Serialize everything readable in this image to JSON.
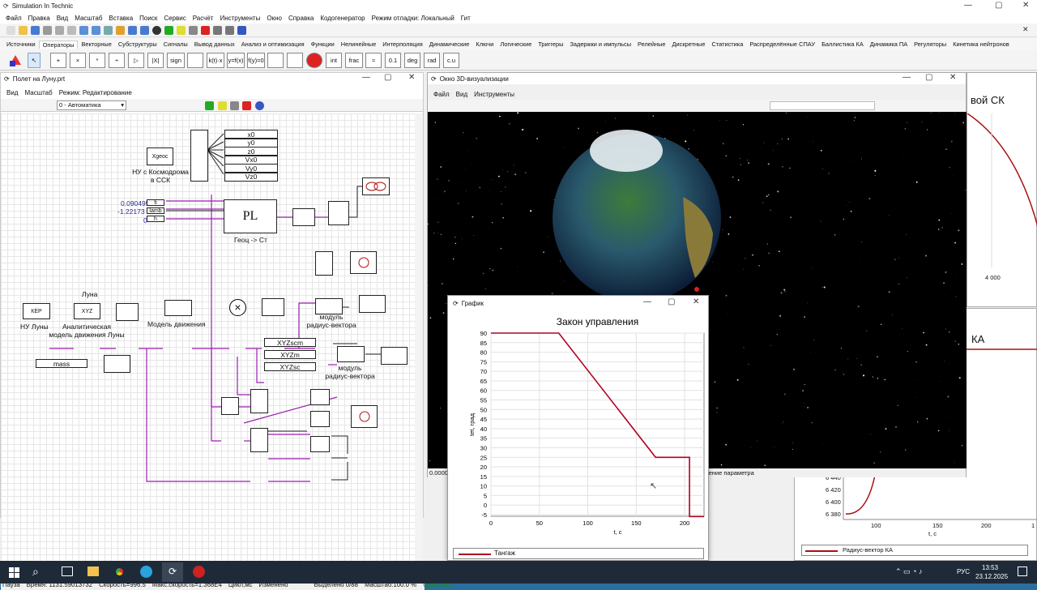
{
  "app": {
    "title": "Simulation In Technic"
  },
  "menu": [
    "Файл",
    "Правка",
    "Вид",
    "Масштаб",
    "Вставка",
    "Поиск",
    "Сервис",
    "Расчёт",
    "Инструменты",
    "Окно",
    "Справка",
    "Кодогенератор",
    "Режим отладки: Локальный",
    "Гит"
  ],
  "tabs": [
    "Источники",
    "Операторы",
    "Векторные",
    "Субструктуры",
    "Сигналы",
    "Вывод данных",
    "Анализ и оптимизация",
    "Функции",
    "Нелинейные",
    "Интерполяция",
    "Динамические",
    "Ключи",
    "Логические",
    "Триггеры",
    "Задержки и импульсы",
    "Релейные",
    "Дискретные",
    "Статистика",
    "Распределённые СПАУ",
    "Баллистика КА",
    "Динамика ПА",
    "Регуляторы",
    "Кинетика нейтронов"
  ],
  "active_tab": "Операторы",
  "operators": [
    "+",
    "×",
    "*",
    "÷",
    "▷",
    "|X|",
    "sign",
    "",
    "k(t)·x",
    "y=f(x)",
    "f(y)=0",
    "",
    "",
    "",
    "int",
    "frac",
    "≈",
    "0.1",
    "deg",
    "rad",
    "c.u"
  ],
  "left_window": {
    "title": "Полет на Луну.prt",
    "menu": [
      "Вид",
      "Масштаб",
      "Режим: Редактирование"
    ],
    "mode_select": "0 - Автоматика",
    "labels": {
      "nu_cosm": "НУ с Космодрома\nв ССК",
      "outputs": [
        "x0",
        "y0",
        "z0",
        "Vx0",
        "Vy0",
        "Vz0"
      ],
      "const1": "0.0904953",
      "const2": "-1.22173",
      "const3": "0",
      "fi": "fi",
      "lamb": "lamb",
      "h": "h",
      "pl": "PL",
      "geoc": "Геоц -> Ст",
      "luna": "Луна",
      "nu_luny": "НУ Луны",
      "analyt": "Аналитическая\nмодель движения Луны",
      "model": "Модель движения",
      "modul1": "модуль\nрадиус-вектора",
      "modul2": "модуль\nрадиус-вектора",
      "xyzscm": "XYZscm",
      "xyzm": "XYZm",
      "xyzsc": "XYZsc",
      "mass": "mass",
      "kep": "КЕР",
      "xyz": "XYZ",
      "xgeoc": "Xgeoc"
    },
    "status": [
      "Пауза",
      "Время: 1131.59013732",
      "Скорость=996.5",
      "Макс.скорость=1.368E4",
      "Цикл,мс",
      "Изменено",
      "Выделено 0/88",
      "Масштаб:100.0 %",
      "Сетка вкл."
    ]
  },
  "win3d": {
    "title": "Окно 3D-визуализации",
    "menu": [
      "Файл",
      "Вид",
      "Инструменты"
    ],
    "bottom_left": "0.00000",
    "bottom_right": "Значение параметра"
  },
  "bg_right_top": {
    "title": "вой СК",
    "tick": "4 000"
  },
  "bg_right_bottom": {
    "title": "КА",
    "ticks_y": [
      "6 440",
      "6 420",
      "6 400",
      "6 380"
    ],
    "ticks_x": [
      "100",
      "150",
      "200",
      "1"
    ],
    "xlabel": "t, c",
    "legend": "Радиус-вектор КА"
  },
  "graph": {
    "title": "График",
    "legend": "Тангаж",
    "chart_data": {
      "type": "line",
      "title": "Закон управления",
      "xlabel": "t, c",
      "ylabel": "tet, град",
      "xlim": [
        0,
        220
      ],
      "ylim": [
        -5,
        90
      ],
      "x_ticks": [
        0,
        50,
        100,
        150,
        200
      ],
      "y_ticks": [
        90,
        85,
        80,
        75,
        70,
        65,
        60,
        55,
        50,
        45,
        40,
        35,
        30,
        25,
        20,
        15,
        10,
        5,
        0,
        -5
      ],
      "grid": true,
      "series": [
        {
          "name": "Тангаж",
          "color": "#b00020",
          "x": [
            0,
            70,
            170,
            205,
            205,
            220
          ],
          "y": [
            90,
            90,
            25,
            25,
            -6,
            -6
          ]
        }
      ]
    }
  },
  "taskbar": {
    "lang": "РУС",
    "time": "13:53",
    "date": "23.12.2025"
  },
  "colors": {
    "accent": "#b00020",
    "taskbar": "#1f2a38",
    "wire": "#9b1fb0"
  }
}
